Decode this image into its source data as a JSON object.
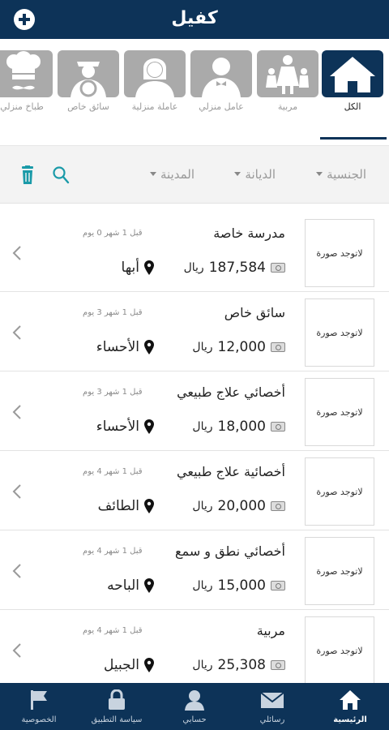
{
  "header": {
    "title": "كفيل"
  },
  "categories": [
    {
      "label": "الكل",
      "icon": "home-icon",
      "active": true
    },
    {
      "label": "مربية",
      "icon": "nanny-icon"
    },
    {
      "label": "عامل منزلي",
      "icon": "butler-icon"
    },
    {
      "label": "عاملة منزلية",
      "icon": "maid-icon"
    },
    {
      "label": "سائق خاص",
      "icon": "driver-icon"
    },
    {
      "label": "طباخ منزلي",
      "icon": "chef-icon"
    }
  ],
  "filters": {
    "nationality": "الجنسية",
    "religion": "الديانة",
    "city": "المدينة"
  },
  "no_photo_text": "لاتوجد صورة",
  "currency": "ريال",
  "listings": [
    {
      "job": "مدرسة خاصة",
      "since": "قبل 1 شهر 0 يوم",
      "salary": "187,584",
      "city": "أبها"
    },
    {
      "job": "سائق خاص",
      "since": "قبل 1 شهر 3 يوم",
      "salary": "12,000",
      "city": "الأحساء"
    },
    {
      "job": "أخصائي علاج طبيعي",
      "since": "قبل 1 شهر 3 يوم",
      "salary": "18,000",
      "city": "الأحساء"
    },
    {
      "job": "أخصائية علاج طبيعي",
      "since": "قبل 1 شهر 4 يوم",
      "salary": "20,000",
      "city": "الطائف"
    },
    {
      "job": "أخصائي نطق و سمع",
      "since": "قبل 1 شهر 4 يوم",
      "salary": "15,000",
      "city": "الباحه"
    },
    {
      "job": "مربية",
      "since": "قبل 1 شهر 4 يوم",
      "salary": "25,308",
      "city": "الجبيل"
    }
  ],
  "bottom_nav": [
    {
      "label": "الرئيسية",
      "icon": "home-icon",
      "active": true
    },
    {
      "label": "رسائلي",
      "icon": "mail-icon"
    },
    {
      "label": "حسابي",
      "icon": "user-icon"
    },
    {
      "label": "سياسة التطبيق",
      "icon": "lock-icon"
    },
    {
      "label": "الخصوصية",
      "icon": "flag-icon"
    }
  ],
  "colors": {
    "primary": "#0d3358",
    "tile_inactive": "#aaaaaa",
    "accent_icon": "#1a9aa8"
  }
}
